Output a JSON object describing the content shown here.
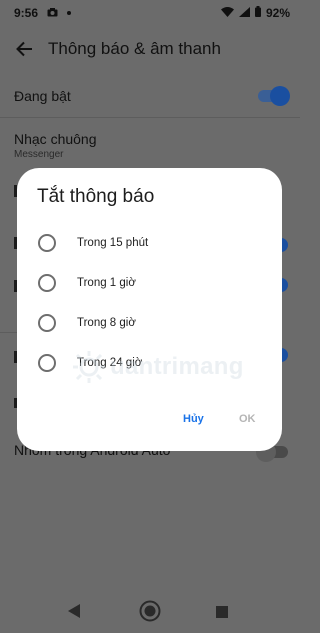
{
  "status": {
    "time": "9:56",
    "battery": "92%"
  },
  "appbar": {
    "title": "Thông báo & âm thanh"
  },
  "settings": {
    "enabled_label": "Đang bật",
    "ringtone_label": "Nhạc chuông",
    "ringtone_sub": "Messenger",
    "android_auto_label": "Nhóm trong Android Auto"
  },
  "dialog": {
    "title": "Tắt thông báo",
    "options": [
      "Trong 15 phút",
      "Trong 1 giờ",
      "Trong 8 giờ",
      "Trong 24 giờ"
    ],
    "cancel_label": "Hủy",
    "ok_label": "OK"
  },
  "colors": {
    "accent": "#1a73e8",
    "toggle_on_track": "#3a5f96",
    "toggle_on_knob": "#1a4fa0",
    "scrim": "#6b6b6b",
    "ok_disabled": "#b5b5b5"
  },
  "icons": [
    "back-arrow-icon",
    "wifi-icon",
    "signal-icon",
    "battery-icon",
    "nav-back-icon",
    "nav-home-icon",
    "nav-recents-icon"
  ]
}
